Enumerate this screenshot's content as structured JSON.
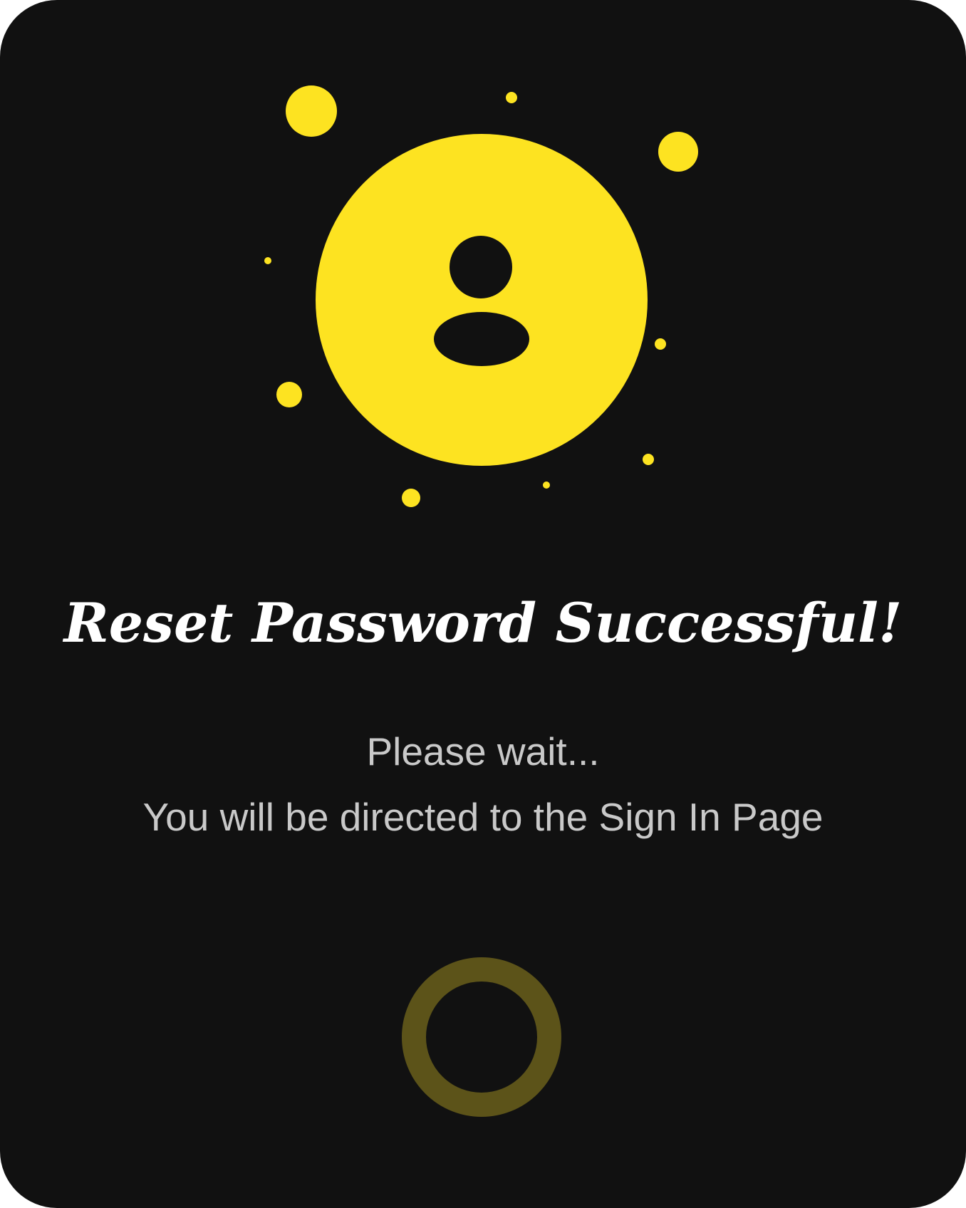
{
  "dialog": {
    "title": "Reset Password Successful!",
    "message_line1": "Please wait...",
    "message_line2": "You will be directed to the Sign In Page"
  },
  "icons": {
    "main": "user-icon",
    "loader": "loading-spinner-icon"
  },
  "colors": {
    "background": "#111111",
    "accent": "#fde321",
    "title": "#ffffff",
    "message": "#c9c9c9",
    "spinner": "#5c5319"
  }
}
